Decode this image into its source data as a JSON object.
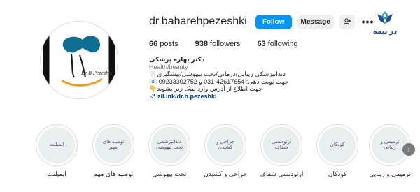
{
  "brand": {
    "text": "در بیمه"
  },
  "profile": {
    "username": "dr.baharehpezeshki",
    "avatar_text": "Dr.B.Pezeshki"
  },
  "actions": {
    "follow": "Follow",
    "message": "Message"
  },
  "stats": [
    {
      "value": "66",
      "label": "posts"
    },
    {
      "value": "938",
      "label": "followers"
    },
    {
      "value": "63",
      "label": "following"
    }
  ],
  "bio": {
    "name": "دکتر بهاره پزشکی",
    "category": "Health/beauty",
    "line1": "دندانپزشکی زیبایی/درمانی/تحت بیهوشی/پیشگیری🦷",
    "line2": "جهت نوبت دهی: 42617654-031 و 09233302752 📧",
    "line3": "جهت اطلاع از آدرس وارد لینک زیر بشوید👇",
    "link": "zil.ink/dr.b.pezeshki"
  },
  "highlights": [
    {
      "inner": "ترمیمی و زیبایی",
      "label": "ترمیمی و زیبایی"
    },
    {
      "inner": "کودکان",
      "label": "کودکان"
    },
    {
      "inner": "ارتودنسی شفاف",
      "label": "ارتودنسی شفاف"
    },
    {
      "inner": "جراحی و کشیدن",
      "label": "جراحی و کشیدن"
    },
    {
      "inner": "دندانپزشکی تحت بیهوشی",
      "label": "تحت بیهوشی"
    },
    {
      "inner": "توصیه های مهم",
      "label": "توصیه های مهم"
    },
    {
      "inner": "ایمپلنت",
      "label": "ایمپلنت"
    }
  ],
  "icons": {
    "more": "more-options-icon",
    "suggest": "add-person-icon",
    "link": "link-icon",
    "next": "chevron-right-icon"
  }
}
